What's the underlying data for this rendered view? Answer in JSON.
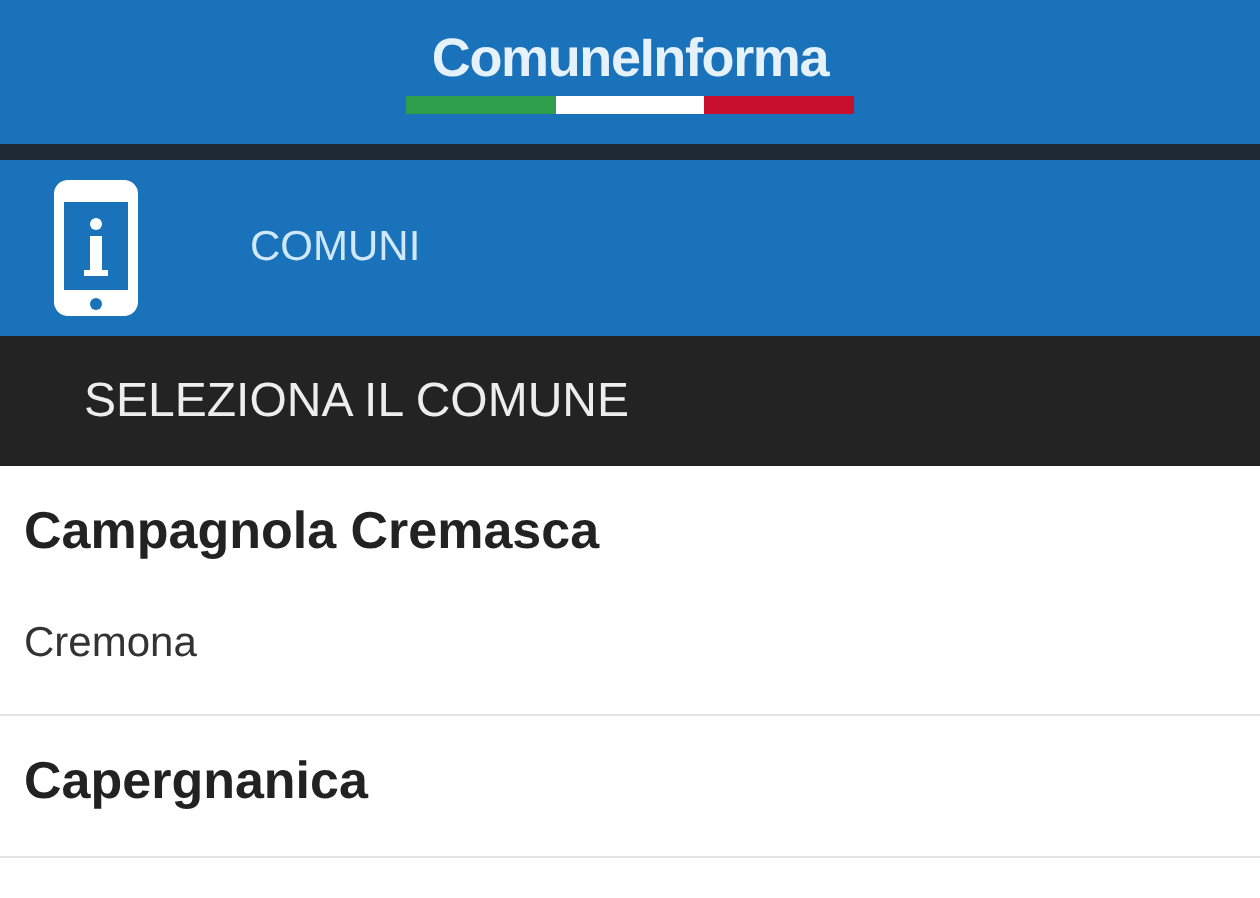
{
  "header": {
    "logo": "ComuneInforma"
  },
  "section": {
    "title": "COMUNI"
  },
  "subheader": {
    "title": "SELEZIONA IL COMUNE"
  },
  "items": [
    {
      "name": "Campagnola Cremasca",
      "province": "Cremona"
    },
    {
      "name": "Capergnanica"
    }
  ]
}
